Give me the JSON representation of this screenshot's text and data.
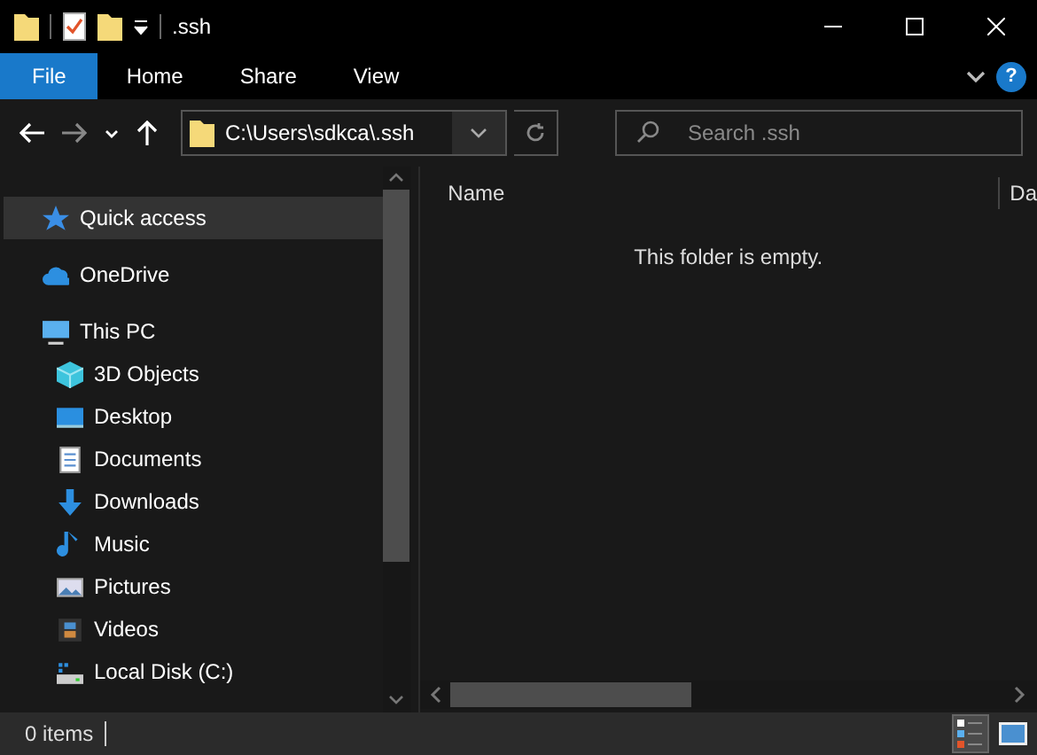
{
  "window": {
    "title": ".ssh"
  },
  "ribbon_tabs": [
    {
      "label": "File",
      "selected": true
    },
    {
      "label": "Home",
      "selected": false
    },
    {
      "label": "Share",
      "selected": false
    },
    {
      "label": "View",
      "selected": false
    }
  ],
  "help_button": {
    "label": "?"
  },
  "address_bar": {
    "path": "C:\\Users\\sdkca\\.ssh"
  },
  "search": {
    "placeholder": "Search .ssh"
  },
  "navigation": [
    {
      "label": "Quick access",
      "kind": "star",
      "selected": true
    },
    {
      "label": "OneDrive",
      "kind": "cloud",
      "selected": false
    },
    {
      "label": "This PC",
      "kind": "pc",
      "selected": false,
      "children": [
        {
          "label": "3D Objects",
          "kind": "cube",
          "selected": false
        },
        {
          "label": "Desktop",
          "kind": "desktop",
          "selected": false
        },
        {
          "label": "Documents",
          "kind": "document",
          "selected": false
        },
        {
          "label": "Downloads",
          "kind": "download",
          "selected": false
        },
        {
          "label": "Music",
          "kind": "music",
          "selected": false
        },
        {
          "label": "Pictures",
          "kind": "picture",
          "selected": false
        },
        {
          "label": "Videos",
          "kind": "video",
          "selected": false
        },
        {
          "label": "Local Disk (C:)",
          "kind": "disk",
          "selected": false
        }
      ]
    }
  ],
  "columns": [
    "Name",
    "Da"
  ],
  "empty_message": "This folder is empty.",
  "status_bar": {
    "item_count": "0 items"
  },
  "view_buttons": [
    {
      "kind": "details",
      "selected": true
    },
    {
      "kind": "large-icons",
      "selected": false
    }
  ]
}
